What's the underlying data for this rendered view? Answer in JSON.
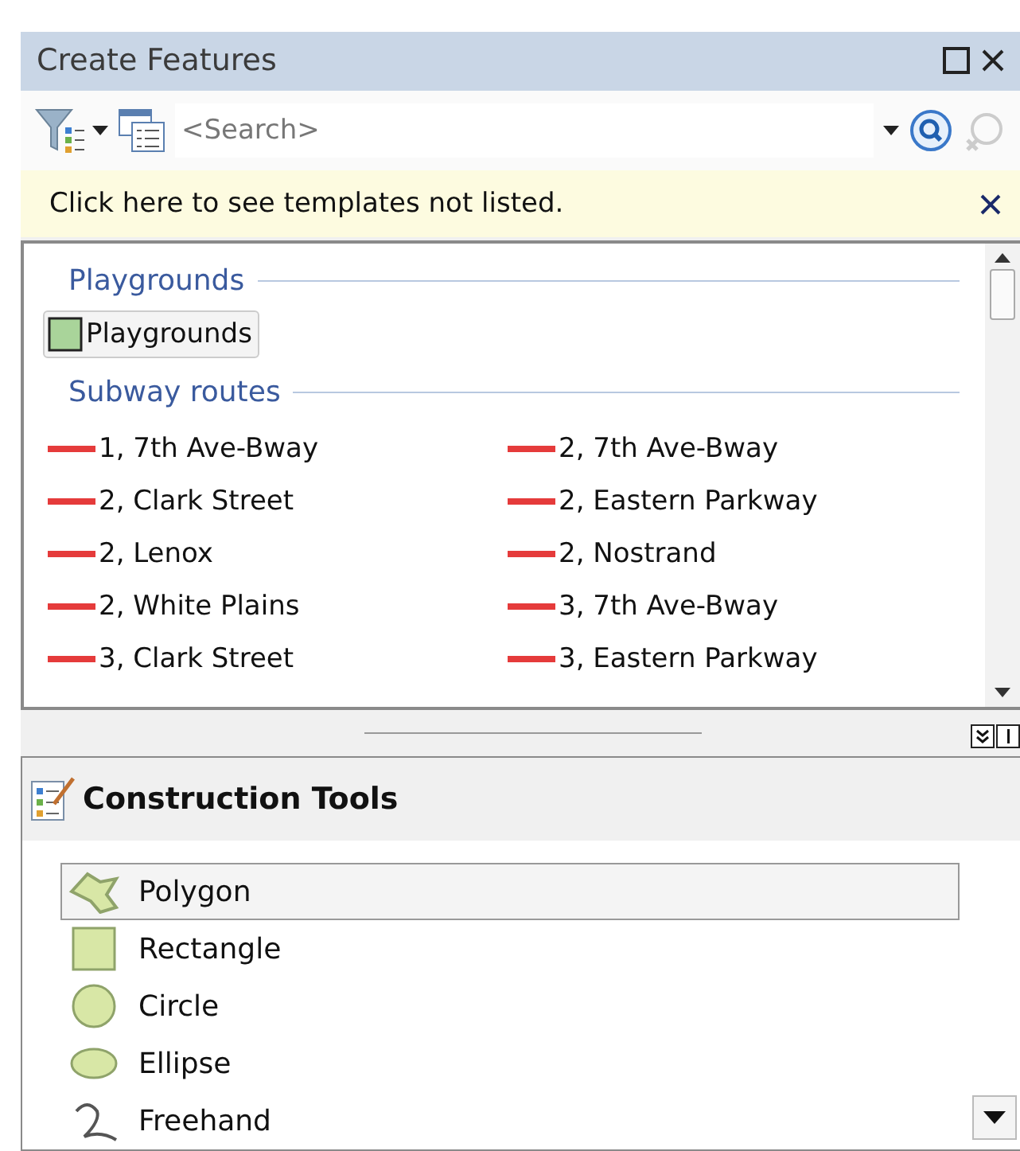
{
  "window": {
    "title": "Create Features"
  },
  "search": {
    "placeholder": "<Search>"
  },
  "notice": {
    "text": "Click here to see templates not listed."
  },
  "template_groups": [
    {
      "title": "Playgrounds",
      "items": [
        {
          "label": "Playgrounds",
          "kind": "polygon",
          "selected": true
        }
      ]
    },
    {
      "title": "Subway routes",
      "items": [
        {
          "label": "1, 7th Ave-Bway",
          "kind": "line",
          "selected": false
        },
        {
          "label": "2, 7th Ave-Bway",
          "kind": "line",
          "selected": false
        },
        {
          "label": "2, Clark Street",
          "kind": "line",
          "selected": false
        },
        {
          "label": "2, Eastern Parkway",
          "kind": "line",
          "selected": false
        },
        {
          "label": "2, Lenox",
          "kind": "line",
          "selected": false
        },
        {
          "label": "2, Nostrand",
          "kind": "line",
          "selected": false
        },
        {
          "label": "2, White Plains",
          "kind": "line",
          "selected": false
        },
        {
          "label": "3, 7th Ave-Bway",
          "kind": "line",
          "selected": false
        },
        {
          "label": "3, Clark Street",
          "kind": "line",
          "selected": false
        },
        {
          "label": "3, Eastern Parkway",
          "kind": "line",
          "selected": false
        }
      ]
    }
  ],
  "construction_tools": {
    "title": "Construction Tools",
    "tools": [
      {
        "label": "Polygon",
        "kind": "polygon",
        "selected": true
      },
      {
        "label": "Rectangle",
        "kind": "rectangle",
        "selected": false
      },
      {
        "label": "Circle",
        "kind": "circle",
        "selected": false
      },
      {
        "label": "Ellipse",
        "kind": "ellipse",
        "selected": false
      },
      {
        "label": "Freehand",
        "kind": "freehand",
        "selected": false
      }
    ]
  }
}
